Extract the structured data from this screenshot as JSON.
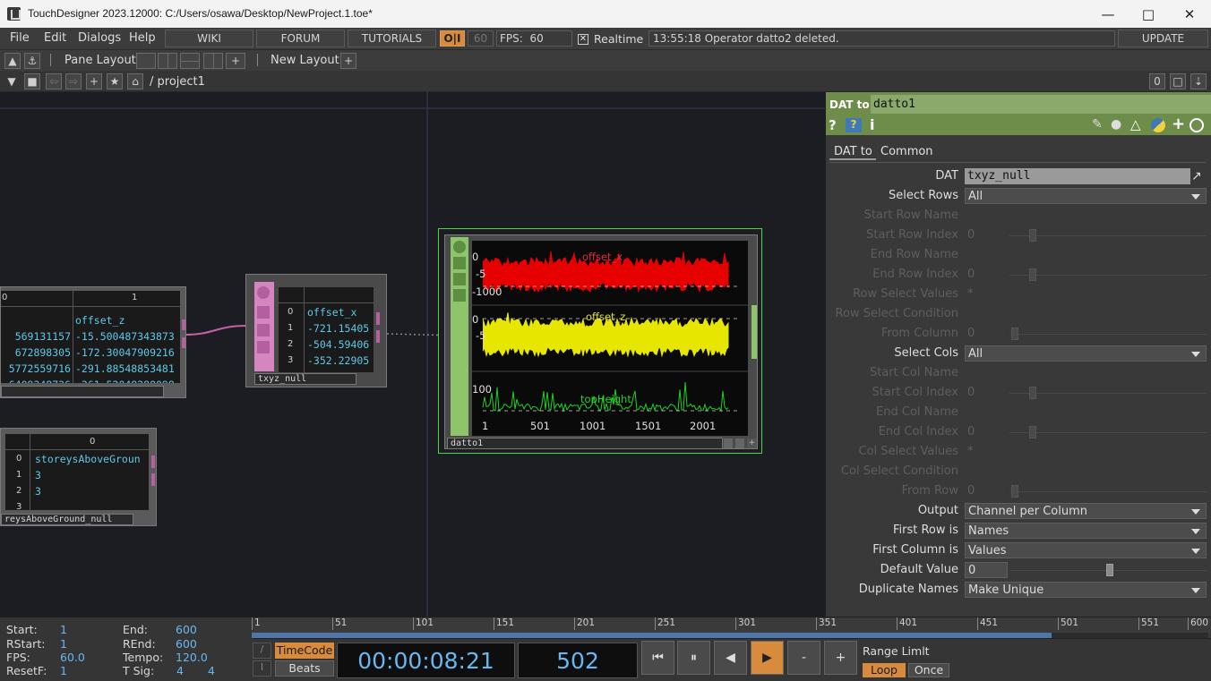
{
  "window": {
    "title": "TouchDesigner 2023.12000: C:/Users/osawa/Desktop/NewProject.1.toe*"
  },
  "menubar": {
    "menus": [
      "File",
      "Edit",
      "Dialogs",
      "Help"
    ],
    "links": [
      "WIKI",
      "FORUM",
      "TUTORIALS"
    ],
    "oi": "O|I",
    "fps_cap": "60",
    "fps_label": "FPS:",
    "fps_value": "60",
    "realtime_label": "Realtime",
    "realtime_checked": "✕",
    "status": "13:55:18 Operator datto2 deleted.",
    "update": "UPDATE"
  },
  "toolbar": {
    "pane_layout": "Pane Layout",
    "new_layout": "New Layout",
    "path": "/ project1",
    "pane_index": "0"
  },
  "network": {
    "left_table": {
      "col_header": "1",
      "col_header0": "0",
      "cells_a": [
        "569131157",
        "672898305",
        "5772559716",
        "6409348736"
      ],
      "cells_b": [
        "offset_z",
        "-15.500487343873",
        "-172.30047909216",
        "-291.88548853481",
        "-361.52048288098"
      ]
    },
    "txyz_null": {
      "label": "txyz_null",
      "header": "offset_x",
      "rows": [
        "0",
        "1",
        "2",
        "3"
      ],
      "values": [
        "offset_x",
        "-721.15405",
        "-504.59406",
        "-352.22905"
      ]
    },
    "storeys_table": {
      "label": "reysAboveGround_null",
      "col_header": "0",
      "rows": [
        "0",
        "1",
        "2",
        "3"
      ],
      "values": [
        "storeysAboveGroun",
        "3",
        "3",
        ""
      ]
    },
    "datto1": {
      "label": "datto1",
      "ch1": "offset_x",
      "ch2": "offset_z",
      "ch3": "topHeight",
      "y1a": "0",
      "y1b": "-5",
      "y1c": "-1000",
      "y2a": "0",
      "y2b": "-5",
      "y3a": "100",
      "xticks": [
        "1",
        "501",
        "1001",
        "1501",
        "2001"
      ]
    }
  },
  "params": {
    "op_type": "DAT to",
    "op_name": "datto1",
    "tabs": [
      "DAT to",
      "Common"
    ],
    "rows": [
      {
        "label": "DAT",
        "value": "txyz_null"
      },
      {
        "label": "Select Rows",
        "value": "All"
      },
      {
        "label": "Start Row Name",
        "value": ""
      },
      {
        "label": "Start Row Index",
        "value": "0"
      },
      {
        "label": "End Row  Name",
        "value": ""
      },
      {
        "label": "End Row Index",
        "value": "0"
      },
      {
        "label": "Row Select Values",
        "value": "*"
      },
      {
        "label": "Row Select Condition",
        "value": ""
      },
      {
        "label": "From Column",
        "value": "0"
      },
      {
        "label": "Select Cols",
        "value": "All"
      },
      {
        "label": "Start Col Name",
        "value": ""
      },
      {
        "label": "Start Col Index",
        "value": "0"
      },
      {
        "label": "End Col Name",
        "value": ""
      },
      {
        "label": "End Col Index",
        "value": "0"
      },
      {
        "label": "Col Select Values",
        "value": "*"
      },
      {
        "label": "Col Select Condition",
        "value": ""
      },
      {
        "label": "From Row",
        "value": "0"
      },
      {
        "label": "Output",
        "value": "Channel per Column"
      },
      {
        "label": "First Row is",
        "value": "Names"
      },
      {
        "label": "First Column is",
        "value": "Values"
      },
      {
        "label": "Default Value",
        "value": "0"
      },
      {
        "label": "Duplicate Names",
        "value": "Make Unique"
      }
    ]
  },
  "timeline": {
    "start_k": "Start:",
    "start_v": "1",
    "end_k": "End:",
    "end_v": "600",
    "rstart_k": "RStart:",
    "rstart_v": "1",
    "rend_k": "REnd:",
    "rend_v": "600",
    "fps_k": "FPS:",
    "fps_v": "60.0",
    "tempo_k": "Tempo:",
    "tempo_v": "120.0",
    "resetf_k": "ResetF:",
    "resetf_v": "1",
    "tsig_k": "T Sig:",
    "tsig_v1": "4",
    "tsig_v2": "4",
    "ruler": [
      "1",
      "51",
      "101",
      "151",
      "201",
      "251",
      "301",
      "351",
      "401",
      "451",
      "501",
      "551",
      "600"
    ],
    "timecode_btn": "TimeCode",
    "beats_btn": "Beats",
    "timecode": "00:00:08:21",
    "frame": "502",
    "range_limit": "Range Limlt",
    "loop": "Loop",
    "once": "Once",
    "transport": [
      "⏮",
      "⏸",
      "◀",
      "▶",
      "-",
      "+"
    ]
  }
}
